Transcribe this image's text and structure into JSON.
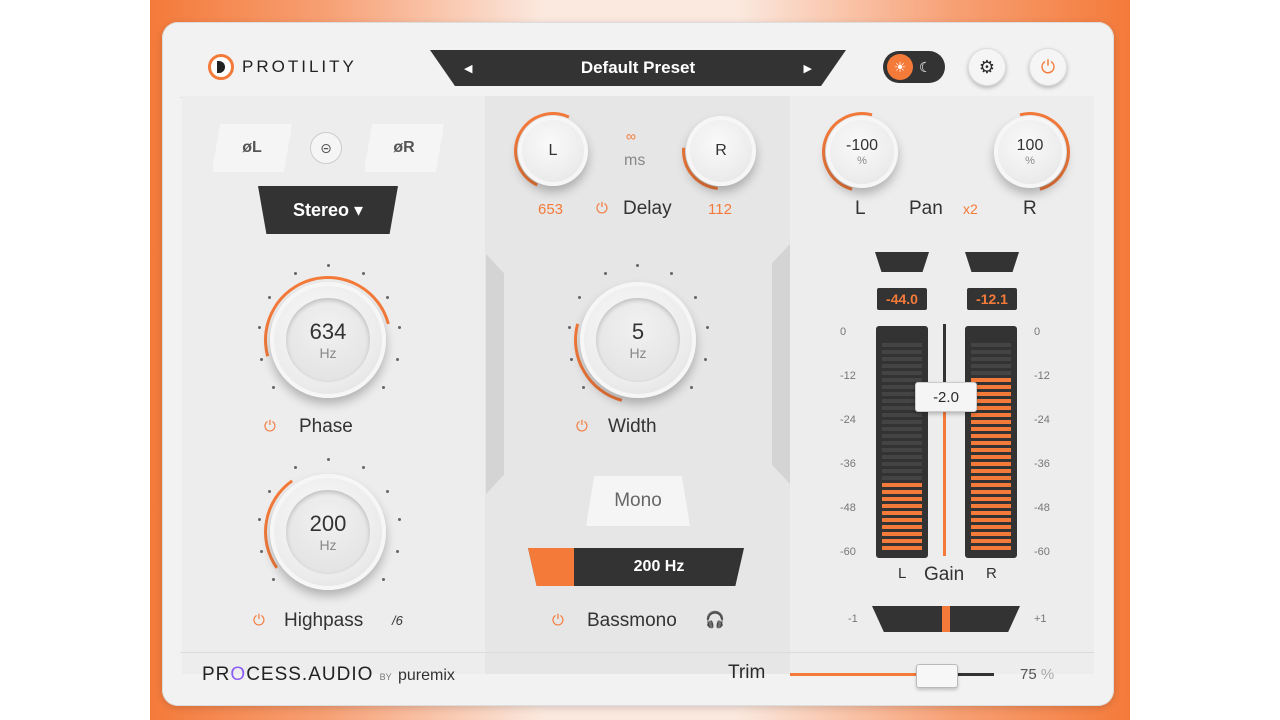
{
  "header": {
    "logo_text": "PROTILITY",
    "preset_name": "Default Preset",
    "preset_prev": "◀",
    "preset_next": "▶",
    "theme_light_icon": "☀",
    "theme_dark_icon": "☾",
    "settings_icon": "⚙",
    "power_icon": "⏻"
  },
  "phase": {
    "left_button": "øL",
    "right_button": "øR",
    "link_icon": "⊝",
    "mode": "Stereo ▾",
    "knob_value": "634",
    "knob_unit": "Hz",
    "label": "Phase",
    "power_icon": "⏻"
  },
  "highpass": {
    "knob_value": "200",
    "knob_unit": "Hz",
    "label": "Highpass",
    "power_icon": "⏻",
    "slope": "/6"
  },
  "delay": {
    "left_knob": "L",
    "right_knob": "R",
    "unit": "ms",
    "link_icon": "∞",
    "left_value": "653",
    "right_value": "112",
    "label": "Delay",
    "power_icon": "⏻"
  },
  "width": {
    "knob_value": "5",
    "knob_unit": "Hz",
    "label": "Width",
    "power_icon": "⏻"
  },
  "mono": {
    "button_label": "Mono"
  },
  "bassmono": {
    "freq": "200 Hz",
    "label": "Bassmono",
    "power_icon": "⏻",
    "headphone_icon": "🎧",
    "fill": 0.2
  },
  "pan": {
    "left_value": "-100",
    "right_value": "100",
    "unit": "%",
    "left_label": "L",
    "right_label": "R",
    "label": "Pan",
    "multiplier": "x2"
  },
  "gain": {
    "left_readout": "-44.0",
    "right_readout": "-12.1",
    "fader_value": "-2.0",
    "label": "Gain",
    "left_label": "L",
    "right_label": "R",
    "scale": [
      "0",
      "-12",
      "-24",
      "-36",
      "-48",
      "-60"
    ],
    "balance_min": "-1",
    "balance_max": "+1",
    "left_level_db": -44.0,
    "right_level_db": -12.1
  },
  "footer": {
    "brand_a": "PR",
    "brand_o": "O",
    "brand_b": "CESS.AUDIO",
    "by": "BY",
    "brand_c": "puremix",
    "trim_label": "Trim",
    "trim_value": "75",
    "trim_unit": "%",
    "trim_fraction": 0.75
  },
  "colors": {
    "accent": "#f47a3a",
    "dark": "#333333",
    "panel": "#ededed"
  }
}
